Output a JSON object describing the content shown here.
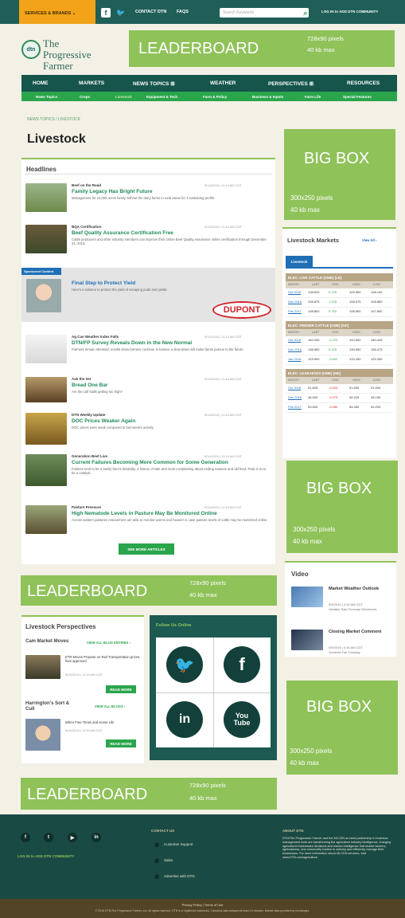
{
  "topbar": {
    "services_label": "SERVICES & BRANDS",
    "contact": "CONTACT DTN",
    "faqs": "FAQS",
    "search_placeholder": "Search Keywords",
    "login": "LOG IN to ADD DTN COMMUNITY"
  },
  "header": {
    "logo_badge": "dtn",
    "logo_text": "The Progressive Farmer"
  },
  "ads": {
    "leaderboard_label": "LEADERBOARD",
    "leaderboard_size": "728x90 pixels",
    "leaderboard_max": "40 kb max",
    "bigbox_label": "BIG BOX",
    "bigbox_size": "300x250 pixels",
    "bigbox_max": "40 kb max"
  },
  "nav": {
    "items": [
      "HOME",
      "MARKETS",
      "NEWS TOPICS ⊞",
      "WEATHER",
      "PERSPECTIVES ⊞",
      "RESOURCES"
    ],
    "sub": [
      "News Topics",
      "Crops",
      "Livestock",
      "Equipment & Tech",
      "Farm & Policy",
      "Business & Inputs",
      "Farm Life",
      "Special Features"
    ]
  },
  "page": {
    "breadcrumb": "NEWS TOPICS / LIVESTOCK",
    "title": "Livestock"
  },
  "headlines": {
    "title": "Headlines",
    "more_button": "SEE MORE ARTICLES",
    "items": [
      {
        "cat": "Beef on the Road",
        "date": "9/14/2016 | 11:14 AM CDT",
        "title": "Family Legacy Has Bright Future",
        "summary": "Management for 23,000 acres family without the dairy farms in rural areas for 4 sustaining profits."
      },
      {
        "cat": "BQA Certification",
        "date": "9/14/2016 | 11:14 AM CDT",
        "title": "Beef Quality Assurance Certification Free",
        "summary": "Cattle producers and other industry members can improve their online Beef Quality Assurance online certification through December 31, 2016."
      },
      {
        "cat": "Sponsored Content",
        "date": "",
        "title": "Final Step to Protect Yield",
        "summary": "Here's a solution to protect the yield of escaping pods and yields."
      },
      {
        "cat": "Ag Can Weather Index Falls",
        "date": "9/14/2016 | 11:14 AM CDT",
        "title": "DTN/FP Survey Reveals Down in the New Normal",
        "summary": "Farmers remain stressed; results show farmers continue to believe a slow-down will make farms pursue to the future."
      },
      {
        "cat": "Ask the Vet",
        "date": "9/14/2016 | 11:14 AM CDT",
        "title": "Bread One Bar",
        "summary": "Are the calf stalls getting too high?"
      },
      {
        "cat": "DTN Weekly Update",
        "date": "9/14/2016 | 11:14 AM CDT",
        "title": "DOC Prices Weaker Again",
        "summary": "DOC prices were weak compared to last week's activity."
      },
      {
        "cat": "Generation Beef Live",
        "date": "9/14/2016 | 11:14 AM CDT",
        "title": "Current Failures Becoming More Common for Some Generation",
        "summary": "Failures tend to be a family farm's disability; a history of sale and most complaining about ending reasons and old feed. Pass it on to be a catalyst."
      },
      {
        "cat": "Pasture Pressure",
        "date": "9/14/2016 | 11:14 AM CDT",
        "title": "High Nematode Levels in Pasture May Be Monitored Online",
        "summary": "Across eastern pastures researchers are able to monitor worms and heavier in case pasture levels of cattle may be monitored online."
      }
    ]
  },
  "sponsor": {
    "brand": "DUPONT"
  },
  "markets": {
    "title": "Livestock Markets",
    "view_all": "View All ›",
    "tab": "Livestock",
    "tables": [
      {
        "name": "ELEC. LIVE CATTLE (CME) [LE]",
        "cols": [
          "MONTH",
          "LAST",
          "CHG",
          "HIGH",
          "LOW"
        ],
        "rows": [
          [
            "Oct 2016",
            "108.825",
            "0.725",
            "109.350",
            "108.100"
          ],
          [
            "Dec 2016",
            "108.875",
            "1.025",
            "108.975",
            "108.850"
          ],
          [
            "Feb 2017",
            "108.800",
            "0.750",
            "108.900",
            "107.600"
          ]
        ]
      },
      {
        "name": "ELEC. FEEDER CATTLE (CME) [GF]",
        "cols": [
          "MONTH",
          "LAST",
          "CHG",
          "HIGH",
          "LOW"
        ],
        "rows": [
          [
            "Oct 2016",
            "140.200",
            "-0.275",
            "143.500",
            "140.425"
          ],
          [
            "Nov 2016",
            "138.500",
            "0.225",
            "139.550",
            "136.475"
          ],
          [
            "Jan 2016",
            "129.900",
            "-0.600",
            "133.250",
            "129.250"
          ]
        ]
      },
      {
        "name": "ELEC. LEAN HOGS (CME) [HE]",
        "cols": [
          "MONTH",
          "LAST",
          "CHG",
          "HIGH",
          "LOW"
        ],
        "rows": [
          [
            "Oct 2016",
            "51.825",
            "-0.025",
            "51.650",
            "51.500"
          ],
          [
            "Dec 2016",
            "48.400",
            "-0.475",
            "49.225",
            "48.150"
          ],
          [
            "Feb 2017",
            "53.500",
            "-0.050",
            "54.450",
            "53.200"
          ]
        ]
      }
    ]
  },
  "video": {
    "title": "Video",
    "items": [
      {
        "title": "Market Weather Outlook",
        "date": "9/9/2016 | 4:15 AM CDT",
        "by": "Variable Rain Forecast Weekends"
      },
      {
        "title": "Closing Market Comment",
        "date": "9/9/2016 | 4:15 AM CDT",
        "by": "Schlecht Fair Tuesday"
      }
    ]
  },
  "perspectives": {
    "title": "Livestock Perspectives",
    "blogs": [
      {
        "name": "Cam Market Moves",
        "link": "VIEW ALL BLOG ENTRIES ›",
        "post": "ETR Moves Propose on Rail Transportation prices, fees approved",
        "date": "9/14/2016 | 11:14 AM CDT",
        "btn": "READ MORE"
      },
      {
        "name": "Harrington's Sort & Cull",
        "link": "VIEW ALL BLOGS ›",
        "post": "When Free Times and Horse Life",
        "date": "9/14/2016 | 11:14 AM CDT",
        "btn": "READ MORE"
      }
    ]
  },
  "follow": {
    "title": "Follow Us Online"
  },
  "footer": {
    "login": "LOG IN to ADD DTN COMMUNITY",
    "contact_head": "CONTACT US",
    "contact_items": [
      "Customer Support",
      "Sales",
      "Advertise with DTN"
    ],
    "about_head": "ABOUT DTN",
    "about_text": "DTN/The Progressive Farmer and the MLCDN an ideal partnership in business management tools are transforming the agriculture industry intelligence, charging agricultural businesses decisions and market intelligence that enable farmers, agribusiness, and commodity traders to actively and efficiently manage their businesses. For more information about MLCDN services, visit www.DTN.com/agriculture.",
    "bottom_links": "Privacy Policy  |  Terms of Use",
    "copyright": "© 2016 DTN/The Progressive Farmer, Inc. All rights reserved. DTN is a registered trademark. Livestock data delayed at least 10 minutes. Market data provided by exchanges."
  }
}
